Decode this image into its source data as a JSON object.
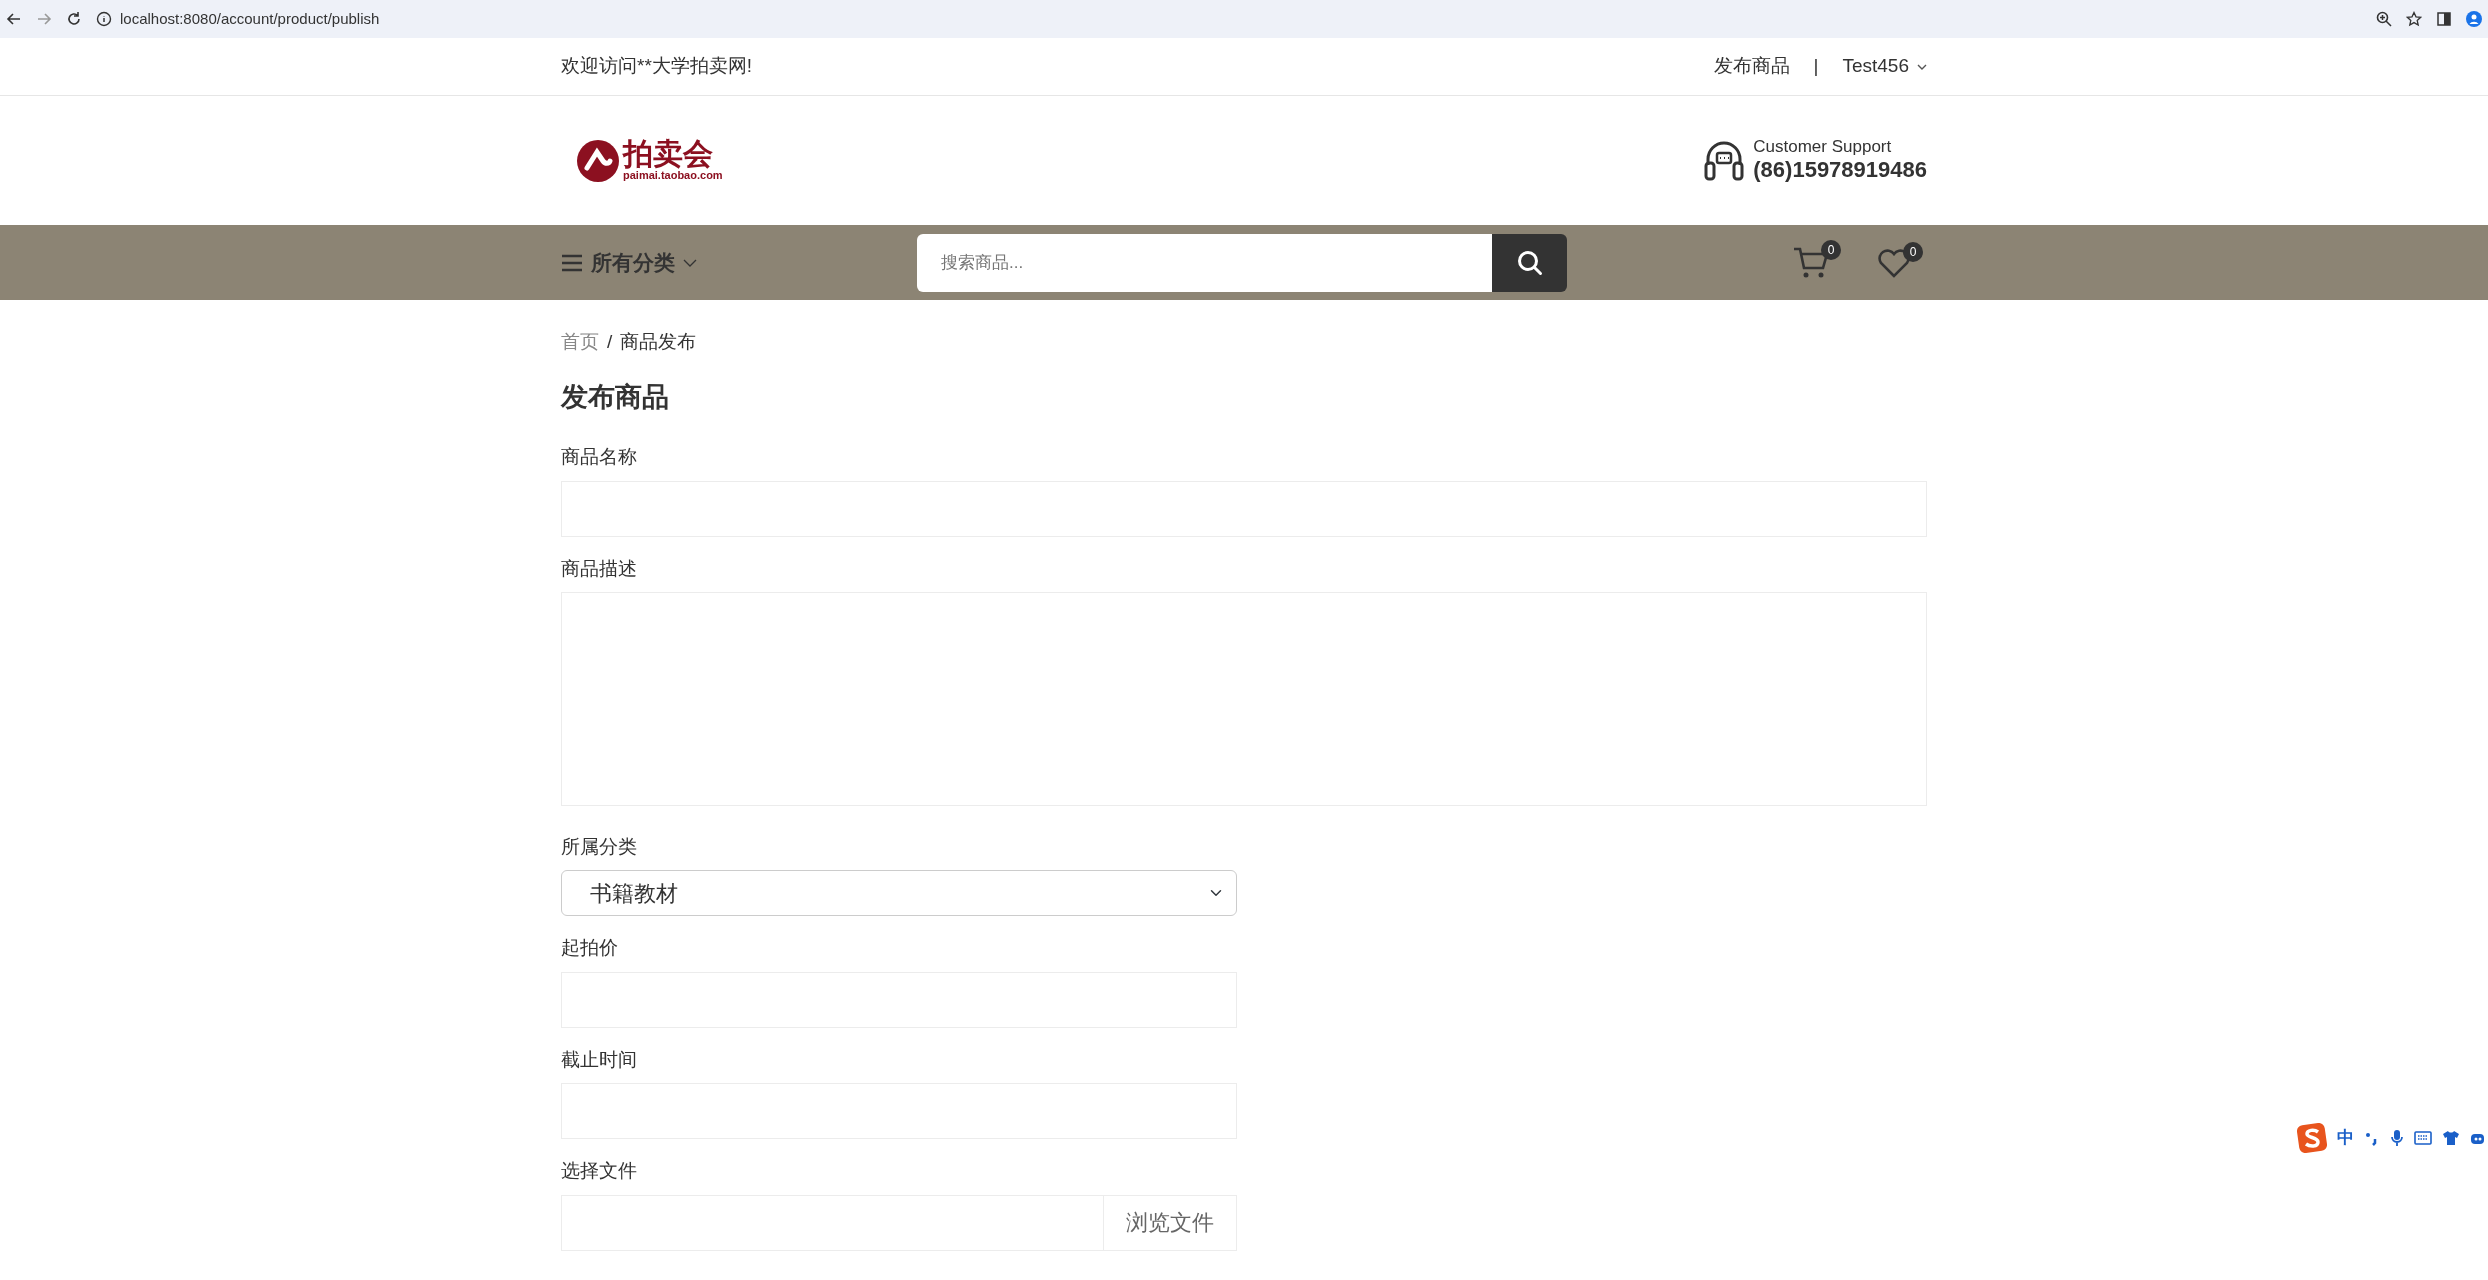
{
  "browser": {
    "url": "localhost:8080/account/product/publish"
  },
  "top_bar": {
    "welcome": "欢迎访问**大学拍卖网!",
    "publish_link": "发布商品",
    "separator": "|",
    "user": "Test456"
  },
  "header": {
    "logo_text": "拍卖会",
    "logo_sub": "paimai.taobao.com",
    "support_label": "Customer Support",
    "support_phone": "(86)15978919486"
  },
  "nav": {
    "categories": "所有分类",
    "search_placeholder": "搜索商品...",
    "cart_count": "0",
    "wishlist_count": "0"
  },
  "breadcrumb": [
    {
      "label": "首页",
      "selected": false
    },
    {
      "label": "商品发布",
      "selected": true
    }
  ],
  "breadcrumb_separator": "/",
  "title": "发布商品",
  "form": [
    {
      "kind": "input",
      "label": "商品名称"
    },
    {
      "kind": "textarea",
      "label": "商品描述"
    },
    {
      "kind": "select",
      "label": "所属分类",
      "value": "书籍教材"
    },
    {
      "kind": "input",
      "label": "起拍价"
    },
    {
      "kind": "input",
      "label": "截止时间"
    },
    {
      "kind": "file",
      "label": "选择文件",
      "button": "浏览文件"
    }
  ],
  "ime_toolbar": {
    "mode": "中"
  }
}
